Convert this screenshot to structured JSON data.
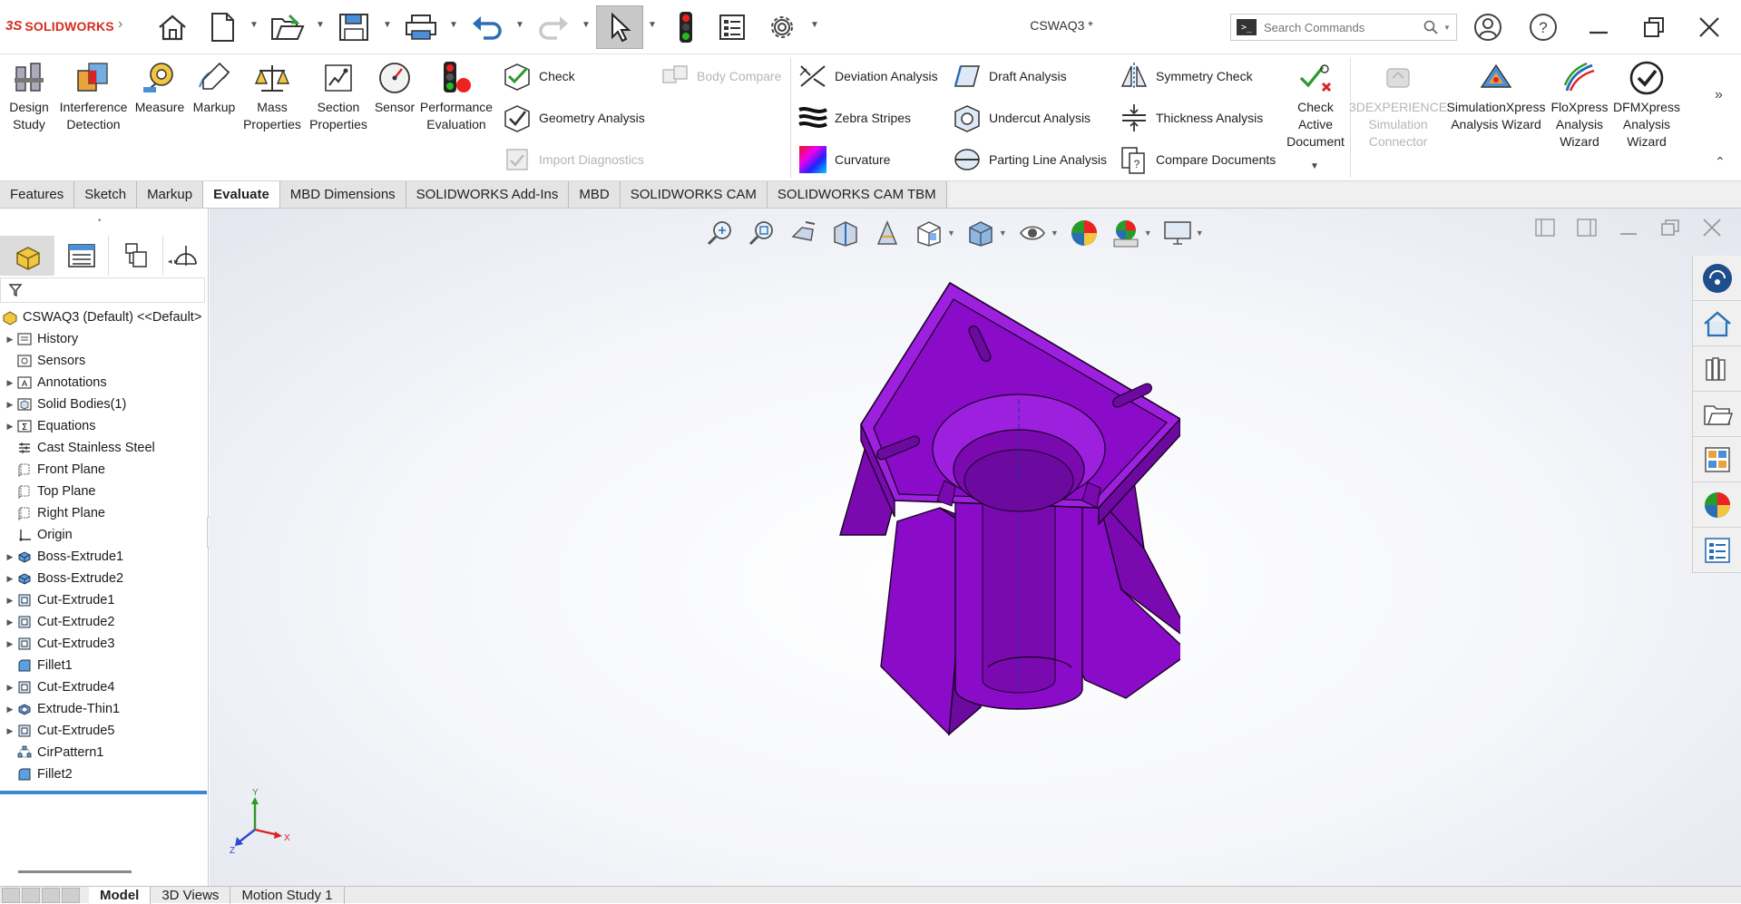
{
  "app": {
    "brand_ds": "3S",
    "brand_name": "SOLIDWORKS",
    "document_title": "CSWAQ3 *"
  },
  "search": {
    "placeholder": "Search Commands"
  },
  "ribbon": {
    "large_buttons": [
      {
        "label": "Design Study",
        "icon": "design-study-icon"
      },
      {
        "label": "Interference Detection",
        "icon": "interference-detection-icon"
      },
      {
        "label": "Measure",
        "icon": "measure-icon"
      },
      {
        "label": "Markup",
        "icon": "markup-icon"
      },
      {
        "label": "Mass Properties",
        "icon": "mass-properties-icon"
      },
      {
        "label": "Section Properties",
        "icon": "section-properties-icon"
      },
      {
        "label": "Sensor",
        "icon": "sensor-icon"
      },
      {
        "label": "Performance Evaluation",
        "icon": "performance-evaluation-icon"
      }
    ],
    "small_buttons": [
      {
        "label": "Check",
        "icon": "check-icon",
        "enabled": true
      },
      {
        "label": "Geometry Analysis",
        "icon": "geometry-analysis-icon",
        "enabled": true
      },
      {
        "label": "Import Diagnostics",
        "icon": "import-diagnostics-icon",
        "enabled": false
      },
      {
        "label": "Body Compare",
        "icon": "body-compare-icon",
        "enabled": false
      },
      {
        "label": "Deviation Analysis",
        "icon": "deviation-analysis-icon",
        "enabled": true
      },
      {
        "label": "Zebra Stripes",
        "icon": "zebra-stripes-icon",
        "enabled": true
      },
      {
        "label": "Curvature",
        "icon": "curvature-icon",
        "enabled": true
      },
      {
        "label": "Draft Analysis",
        "icon": "draft-analysis-icon",
        "enabled": true
      },
      {
        "label": "Undercut Analysis",
        "icon": "undercut-analysis-icon",
        "enabled": true
      },
      {
        "label": "Parting Line Analysis",
        "icon": "parting-line-analysis-icon",
        "enabled": true
      },
      {
        "label": "Symmetry Check",
        "icon": "symmetry-check-icon",
        "enabled": true
      },
      {
        "label": "Thickness Analysis",
        "icon": "thickness-analysis-icon",
        "enabled": true
      },
      {
        "label": "Compare Documents",
        "icon": "compare-documents-icon",
        "enabled": true
      }
    ],
    "right_buttons": [
      {
        "label": "Check Active Document",
        "icon": "check-active-document-icon",
        "enabled": true
      },
      {
        "label": "3DEXPERIENCE Simulation Connector",
        "icon": "3dexperience-icon",
        "enabled": false
      },
      {
        "label": "SimulationXpress Analysis Wizard",
        "icon": "simulationxpress-icon",
        "enabled": true
      },
      {
        "label": "FloXpress Analysis Wizard",
        "icon": "floxpress-icon",
        "enabled": true
      },
      {
        "label": "DFMXpress Analysis Wizard",
        "icon": "dfmxpress-icon",
        "enabled": true
      }
    ]
  },
  "tabs": [
    "Features",
    "Sketch",
    "Markup",
    "Evaluate",
    "MBD Dimensions",
    "SOLIDWORKS Add-Ins",
    "MBD",
    "SOLIDWORKS CAM",
    "SOLIDWORKS CAM TBM"
  ],
  "active_tab": "Evaluate",
  "tree": {
    "root": "CSWAQ3 (Default) <<Default>",
    "items": [
      {
        "label": "History",
        "expandable": true,
        "icon": "history-icon"
      },
      {
        "label": "Sensors",
        "expandable": false,
        "icon": "sensors-icon"
      },
      {
        "label": "Annotations",
        "expandable": true,
        "icon": "annotations-icon"
      },
      {
        "label": "Solid Bodies(1)",
        "expandable": true,
        "icon": "solid-bodies-icon"
      },
      {
        "label": "Equations",
        "expandable": true,
        "icon": "equations-icon"
      },
      {
        "label": "Cast Stainless Steel",
        "expandable": false,
        "icon": "material-icon"
      },
      {
        "label": "Front Plane",
        "expandable": false,
        "icon": "plane-icon"
      },
      {
        "label": "Top Plane",
        "expandable": false,
        "icon": "plane-icon"
      },
      {
        "label": "Right Plane",
        "expandable": false,
        "icon": "plane-icon"
      },
      {
        "label": "Origin",
        "expandable": false,
        "icon": "origin-icon"
      },
      {
        "label": "Boss-Extrude1",
        "expandable": true,
        "icon": "boss-extrude-icon"
      },
      {
        "label": "Boss-Extrude2",
        "expandable": true,
        "icon": "boss-extrude-icon"
      },
      {
        "label": "Cut-Extrude1",
        "expandable": true,
        "icon": "cut-extrude-icon"
      },
      {
        "label": "Cut-Extrude2",
        "expandable": true,
        "icon": "cut-extrude-icon"
      },
      {
        "label": "Cut-Extrude3",
        "expandable": true,
        "icon": "cut-extrude-icon"
      },
      {
        "label": "Fillet1",
        "expandable": false,
        "icon": "fillet-icon"
      },
      {
        "label": "Cut-Extrude4",
        "expandable": true,
        "icon": "cut-extrude-icon"
      },
      {
        "label": "Extrude-Thin1",
        "expandable": true,
        "icon": "extrude-thin-icon"
      },
      {
        "label": "Cut-Extrude5",
        "expandable": true,
        "icon": "cut-extrude-icon"
      },
      {
        "label": "CirPattern1",
        "expandable": false,
        "icon": "circular-pattern-icon"
      },
      {
        "label": "Fillet2",
        "expandable": false,
        "icon": "fillet-icon"
      }
    ]
  },
  "bottom_tabs": [
    "Model",
    "3D Views",
    "Motion Study 1"
  ],
  "active_bottom_tab": "Model",
  "triad": {
    "x": "X",
    "y": "Y",
    "z": "Z"
  },
  "colors": {
    "part": "#8a0cc8",
    "brand": "#d52b1e",
    "selection_line": "#3a87d2"
  }
}
